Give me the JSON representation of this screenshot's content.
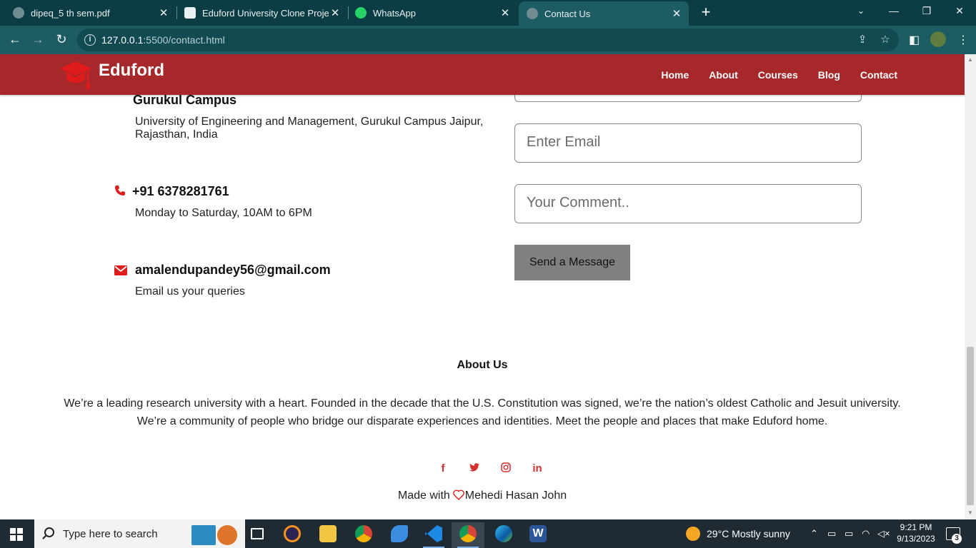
{
  "browser": {
    "tabs": [
      {
        "title": "dipeq_5 th sem.pdf",
        "active": false
      },
      {
        "title": "Eduford University Clone Project",
        "active": false
      },
      {
        "title": "WhatsApp",
        "active": false
      },
      {
        "title": "Contact Us",
        "active": true
      }
    ],
    "url_host": "127.0.0.1",
    "url_rest": ":5500/contact.html"
  },
  "site": {
    "brand": "Eduford",
    "nav": [
      "Home",
      "About",
      "Courses",
      "Blog",
      "Contact"
    ],
    "brand_color": "#a7282a"
  },
  "contact": {
    "campus_title": "Gurukul Campus",
    "campus_address": "University of Engineering and Management, Gurukul Campus Jaipur, Rajasthan, India",
    "phone": "+91 6378281761",
    "phone_hours": "Monday to Saturday, 10AM to 6PM",
    "email": "amalendupandey56@gmail.com",
    "email_note": "Email us your queries"
  },
  "form": {
    "email_placeholder": "Enter Email",
    "comment_placeholder": "Your Comment..",
    "send_label": "Send a Message"
  },
  "footer": {
    "about_title": "About Us",
    "about_text": "We’re a leading research university with a heart. Founded in the decade that the U.S. Constitution was signed, we’re the nation’s oldest Catholic and Jesuit university. We’re a community of people who bridge our disparate experiences and identities. Meet the people and places that make Eduford home.",
    "socials": [
      "facebook-icon",
      "twitter-icon",
      "instagram-icon",
      "linkedin-icon"
    ],
    "made_with": "Made with",
    "author": "Mehedi Hasan John"
  },
  "taskbar": {
    "search_placeholder": "Type here to search",
    "weather": "29°C  Mostly sunny",
    "time": "9:21 PM",
    "date": "9/13/2023",
    "notifications": "3"
  }
}
